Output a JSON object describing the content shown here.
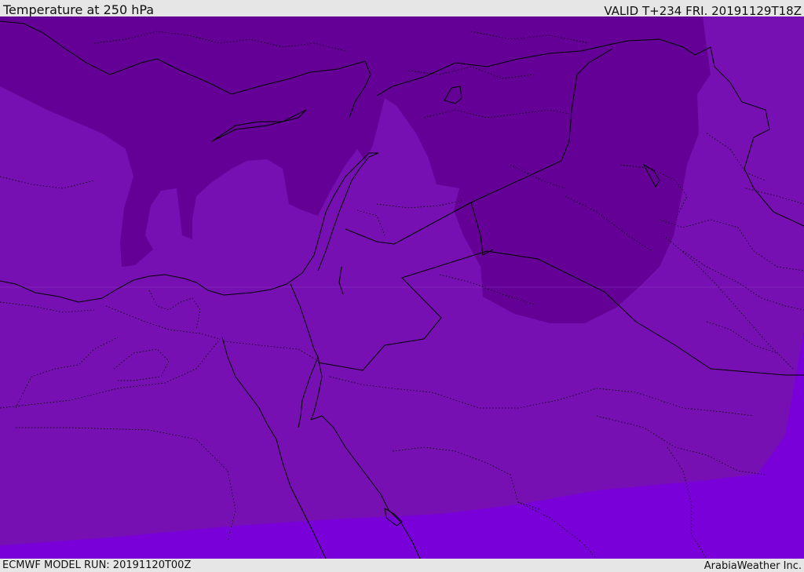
{
  "header": {
    "title": "Temperature at 250 hPa",
    "valid": "VALID T+234 FRI. 20191129T18Z"
  },
  "footer": {
    "model_run": "ECMWF MODEL RUN: 20191120T00Z",
    "credit": "ArabiaWeather Inc."
  },
  "map": {
    "colors": {
      "coldest": "#640096",
      "base": "#7710b2",
      "warm": "#7a00d9",
      "border": "#000000"
    }
  }
}
